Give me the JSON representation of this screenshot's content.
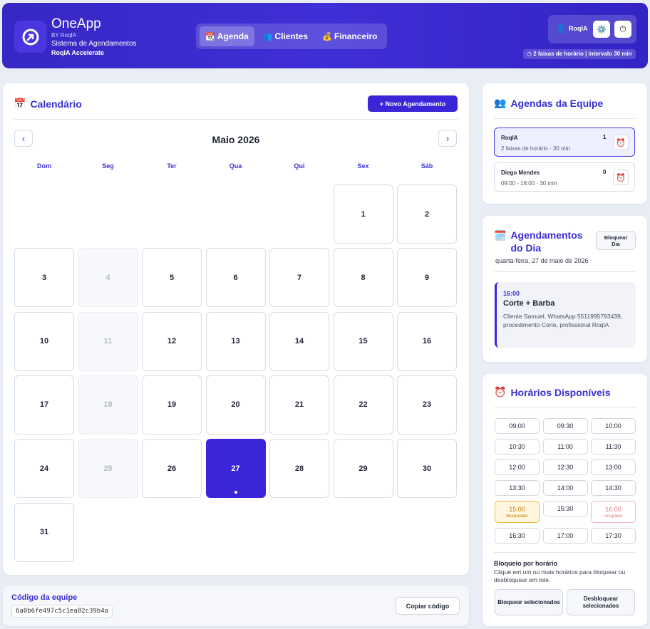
{
  "app": {
    "name": "OneApp",
    "by": "BY RoqIA",
    "subtitle": "Sistema de Agendamentos",
    "accelerate": "RoqIA Accelerate"
  },
  "nav": [
    {
      "icon": "📆",
      "label": "Agenda"
    },
    {
      "icon": "👥",
      "label": "Clientes"
    },
    {
      "icon": "💰",
      "label": "Financeiro"
    }
  ],
  "user": {
    "icon": "👤",
    "name": "RoqIA",
    "settings_icon": "⚙️",
    "power_icon": "⏻",
    "meta": "◷ 2 faixas de horário | intervalo 30 min"
  },
  "calendar": {
    "icon": "📅",
    "title": "Calendário",
    "new_button": "+  Novo Agendamento",
    "prev": "‹",
    "next": "›",
    "month": "Maio 2026",
    "weekdays": [
      "Dom",
      "Seg",
      "Ter",
      "Qua",
      "Qui",
      "Sex",
      "Sáb"
    ],
    "first_weekday": 5,
    "days_in_month": 31,
    "disabled_days": [
      4,
      11,
      18,
      25
    ],
    "selected_day": 27
  },
  "team_code": {
    "title": "Código da equipe",
    "value": "6a0b6fe497c5c1ea82c39b4a",
    "copy_button": "Copiar código"
  },
  "team": {
    "icon": "👥",
    "title": "Agendas da Equipe",
    "members": [
      {
        "name": "RoqIA",
        "schedule": "2 faixas de horário · 30 min",
        "count": "1",
        "icon": "⏰"
      },
      {
        "name": "Diego Mendes",
        "schedule": "09:00 - 18:00 · 30 min",
        "count": "0",
        "icon": "⏰"
      }
    ]
  },
  "day_appointments": {
    "icon": "🗓️",
    "title": "Agendamentos do Dia",
    "block_button": "Bloquear Dia",
    "date": "quarta-feira, 27 de maio de 2026",
    "items": [
      {
        "time": "16:00",
        "title": "Corte + Barba",
        "description": "Cliente Samuel, WhatsApp 5511995793439, procedimento Corte, profissional RoqIA"
      }
    ]
  },
  "available": {
    "icon": "⏰",
    "title": "Horários Disponíveis",
    "slots": [
      {
        "time": "09:00"
      },
      {
        "time": "09:30"
      },
      {
        "time": "10:00"
      },
      {
        "time": "10:30"
      },
      {
        "time": "11:00"
      },
      {
        "time": "11:30"
      },
      {
        "time": "12:00"
      },
      {
        "time": "12:30"
      },
      {
        "time": "13:00"
      },
      {
        "time": "13:30"
      },
      {
        "time": "14:00"
      },
      {
        "time": "14:30"
      },
      {
        "time": "15:00",
        "status": "bloqueado"
      },
      {
        "time": "15:30"
      },
      {
        "time": "16:00",
        "status": "ocupado"
      },
      {
        "time": "16:30"
      },
      {
        "time": "17:00"
      },
      {
        "time": "17:30"
      }
    ],
    "block_section_title": "Bloqueio por horário",
    "block_section_desc": "Clique em um ou mais horários para bloquear ou desbloquear em lote.",
    "block_selected": "Bloquear selecionados",
    "unblock_selected": "Desbloquear selecionados"
  }
}
